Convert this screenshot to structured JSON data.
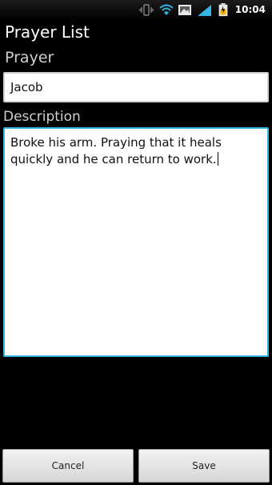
{
  "status_bar": {
    "time": "10:04",
    "icons": [
      "vibrate-icon",
      "wifi-icon",
      "sim-icon",
      "signal-icon",
      "battery-icon"
    ],
    "accent_color": "#33b5e5"
  },
  "app": {
    "title": "Prayer List"
  },
  "form": {
    "prayer_label": "Prayer",
    "prayer_value": "Jacob",
    "description_label": "Description",
    "description_value": "Broke his arm. Praying that it heals quickly and he can return to work."
  },
  "buttons": {
    "cancel_label": "Cancel",
    "save_label": "Save"
  }
}
